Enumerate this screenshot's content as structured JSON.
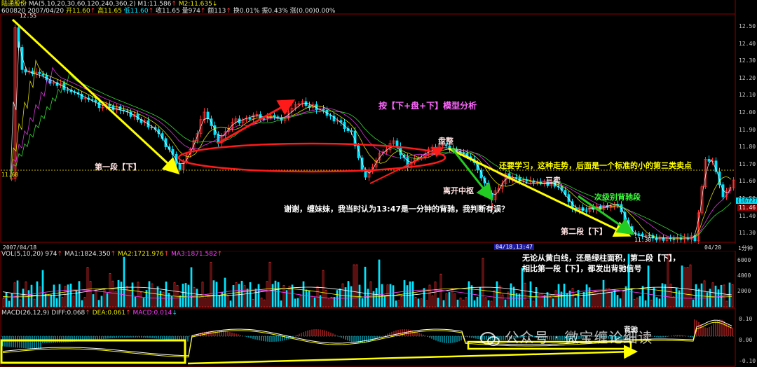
{
  "header": {
    "stock_name": "陆通股份",
    "ma_label": "MA(5,10,20,30,60,120,240,360,2)",
    "m1": "M1:11.586",
    "m2": "M2:11.635",
    "row2_code": "600820 2007/04/20",
    "open": "开11.60",
    "high": "高11.65",
    "low": "低11.60",
    "close": "收11.65",
    "vol": "量974",
    "amount": "额113",
    "turnover": "换0.01%",
    "amplitude": "振0.43%",
    "change": "涨(0.00)0.00%"
  },
  "price_axis": [
    "12.50",
    "12.40",
    "12.30",
    "12.20",
    "12.10",
    "12.00",
    "11.90",
    "11.80",
    "11.70",
    "11.60",
    "11.50",
    "11.40",
    "11.30"
  ],
  "price_labels": {
    "left_level": "11.68",
    "high_mark": "12.55",
    "low_mark": "11.30",
    "current_tag": "16727",
    "current_price": "11.46"
  },
  "time_axis": {
    "start": "2007/04/18",
    "cursor": "04/18,13:47",
    "end": "04/20",
    "period": "1分钟"
  },
  "volume": {
    "label": "VOL(5,10,20)",
    "v": "974",
    "ma1": "MA1:1824.350",
    "ma2": "MA2:1721.976",
    "ma3": "MA3:1871.582",
    "axis": [
      "6000",
      "4000",
      "2000"
    ]
  },
  "macd": {
    "label": "MACD(26,12,9)",
    "diff": "DIFF:0.068",
    "dea": "DEA:0.061",
    "macd": "MACD:0.014",
    "axis": [
      "0.10",
      "0.00",
      "-0.10"
    ]
  },
  "annotations": {
    "title": "按【下+盘+下】模型分析",
    "seg1": "第一段【下】",
    "panzheng": "盘整",
    "likai": "离开中枢",
    "sanmai": "三卖",
    "ciji": "次级别背驰段",
    "seg2": "第二段【下】",
    "note_top": "还要学习，这种走势，后面是一个标准的小的第三类卖点",
    "question": "谢谢，缠妹妹，我当时认为13:47是一分钟的背驰，我判断有误？",
    "vol_note1": "无论从黄白线，还是绿柱面积，第二段【下】，",
    "vol_note2": "相比第一段【下】，都发出背驰信号",
    "beichi": "背驰"
  },
  "watermark": "公众号 · 微宝缠论细读",
  "colors": {
    "bg": "#000000",
    "up": "#ff3030",
    "down": "#00e5ff",
    "arrow_yellow": "#ffff00",
    "arrow_red": "#ff2020",
    "arrow_green": "#22cc22"
  }
}
